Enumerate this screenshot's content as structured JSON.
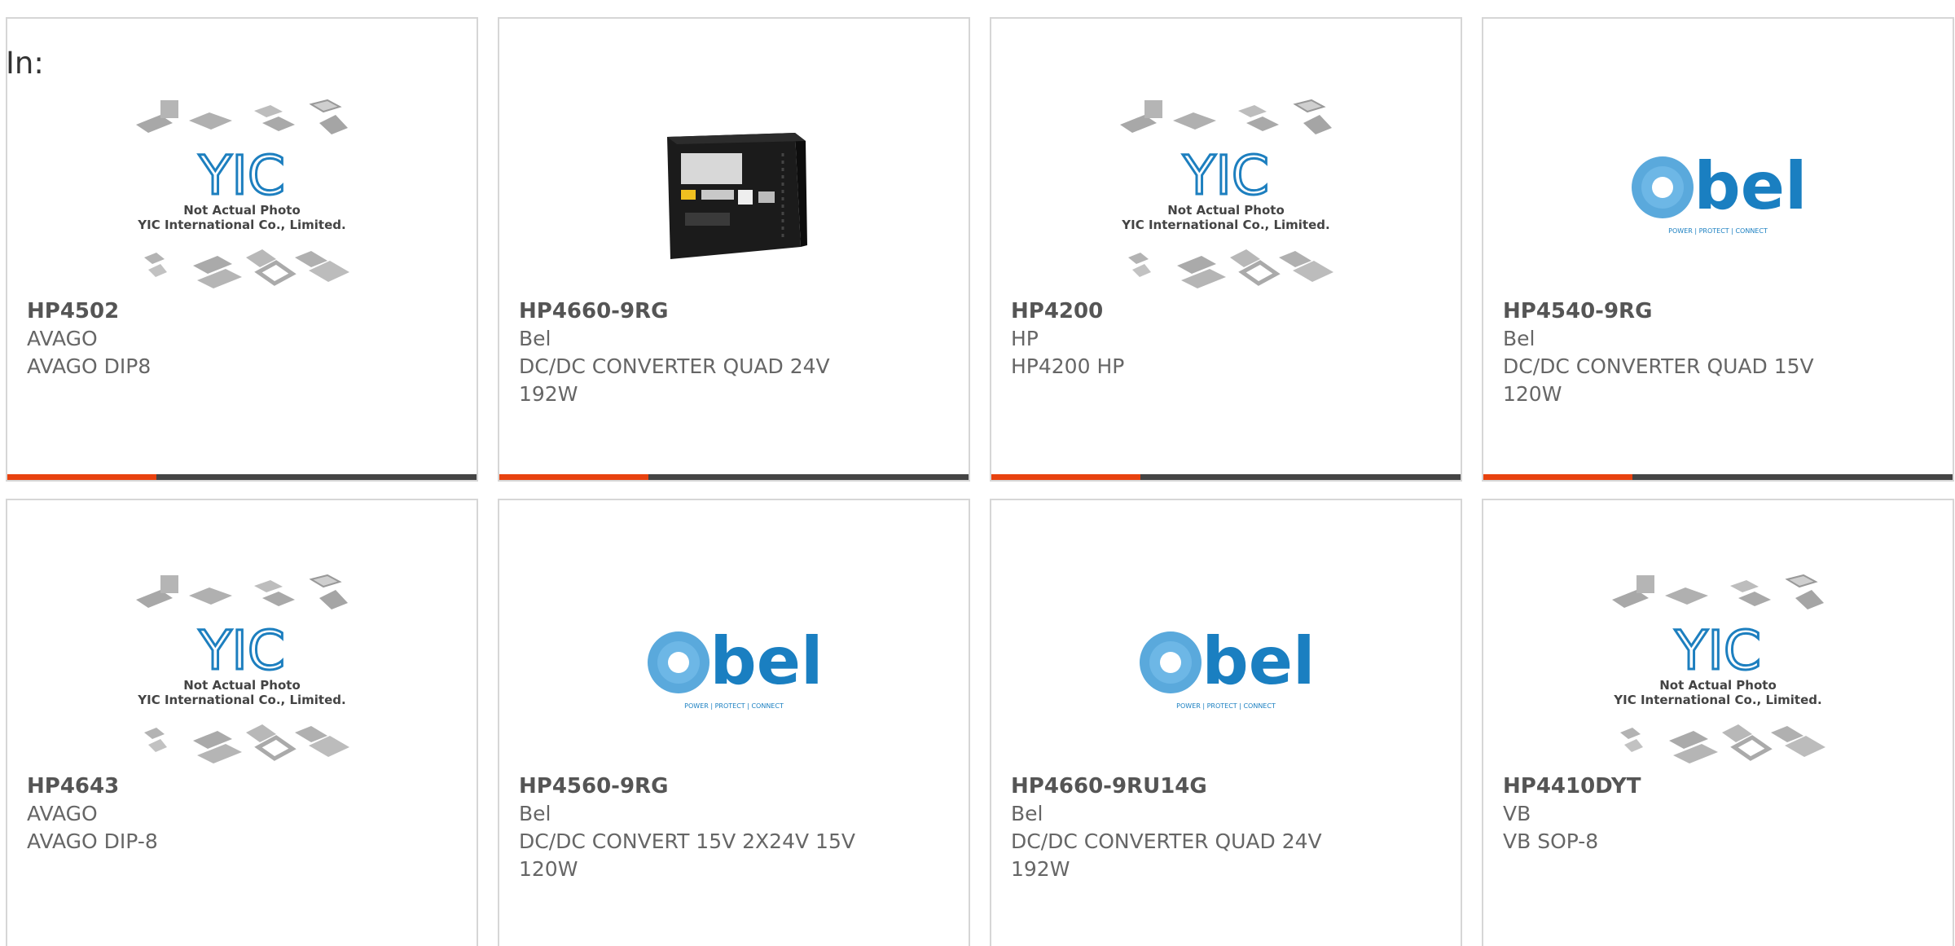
{
  "page": {
    "label": "In:"
  },
  "products": [
    {
      "part_no": "HP4502",
      "maker": "AVAGO",
      "description": "AVAGO DIP8",
      "image": "placeholder"
    },
    {
      "part_no": "HP4660-9RG",
      "maker": "Bel",
      "description": "DC/DC CONVERTER QUAD 24V 192W",
      "image": "module"
    },
    {
      "part_no": "HP4200",
      "maker": "HP",
      "description": "HP4200 HP",
      "image": "placeholder"
    },
    {
      "part_no": "HP4540-9RG",
      "maker": "Bel",
      "description": "DC/DC CONVERTER QUAD 15V 120W",
      "image": "bel-logo"
    },
    {
      "part_no": "HP4643",
      "maker": "AVAGO",
      "description": "AVAGO DIP-8",
      "image": "placeholder"
    },
    {
      "part_no": "HP4560-9RG",
      "maker": "Bel",
      "description": "DC/DC CONVERT 15V 2X24V 15V 120W",
      "image": "bel-logo"
    },
    {
      "part_no": "HP4660-9RU14G",
      "maker": "Bel",
      "description": "DC/DC CONVERTER QUAD 24V 192W",
      "image": "bel-logo"
    },
    {
      "part_no": "HP4410DYT",
      "maker": "VB",
      "description": "VB SOP-8",
      "image": "placeholder"
    }
  ],
  "placeholder_image": {
    "line1": "Not Actual Photo",
    "line2": "YIC International Co., Limited.",
    "logo_text": "YIC"
  },
  "bel_logo": {
    "wordmark": "bel",
    "tagline": "POWER | PROTECT | CONNECT",
    "color": "#1a7fc1"
  },
  "colors": {
    "accent": "#e8420f",
    "bar": "#444444",
    "border": "#d6d6d6"
  }
}
